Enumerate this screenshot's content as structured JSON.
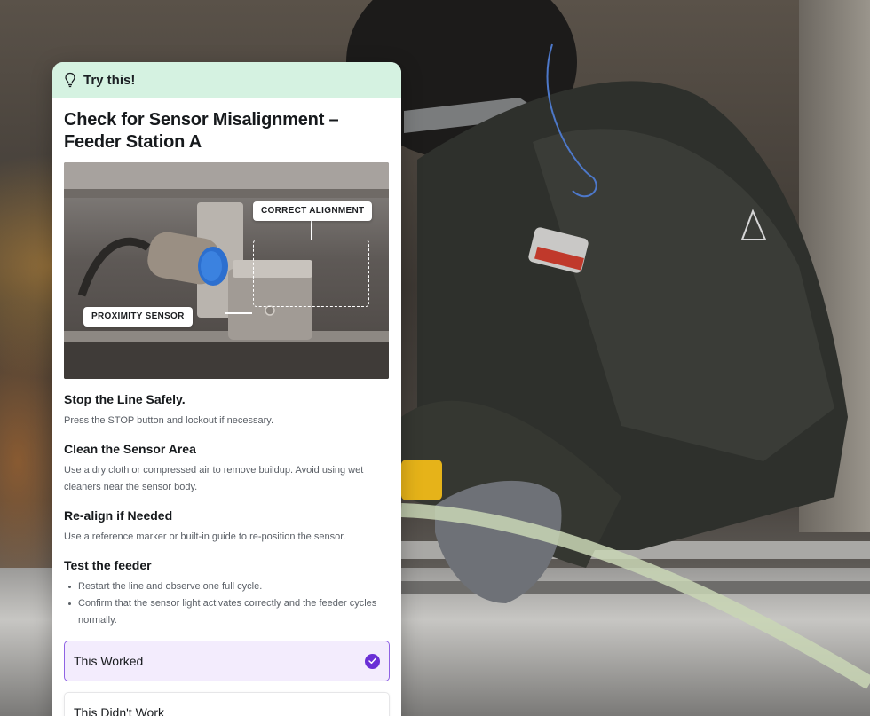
{
  "card": {
    "header_label": "Try this!",
    "header_icon": "lightbulb-icon",
    "title": "Check for Sensor Misalignment – Feeder Station A",
    "image": {
      "label_correct": "CORRECT ALIGNMENT",
      "label_sensor": "PROXIMITY SENSOR"
    },
    "steps": [
      {
        "heading": "Stop the Line Safely.",
        "text": "Press the STOP button and lockout if necessary."
      },
      {
        "heading": "Clean the Sensor Area",
        "text": "Use a dry cloth or compressed air to remove buildup. Avoid using wet cleaners near the sensor body."
      },
      {
        "heading": "Re-align if Needed",
        "text": "Use a reference marker or built-in guide to re-position the sensor."
      },
      {
        "heading": "Test the feeder",
        "bullets": [
          "Restart the line and observe one full cycle.",
          "Confirm that the sensor light activates correctly and the feeder cycles normally."
        ]
      }
    ],
    "options": {
      "worked": "This Worked",
      "not_worked": "This Didn't Work",
      "selected": "worked"
    }
  },
  "colors": {
    "header_bg": "#d5f2e1",
    "accent": "#6a2fd6",
    "selected_bg": "#f3ecfd",
    "selected_border": "#8f63e4"
  }
}
